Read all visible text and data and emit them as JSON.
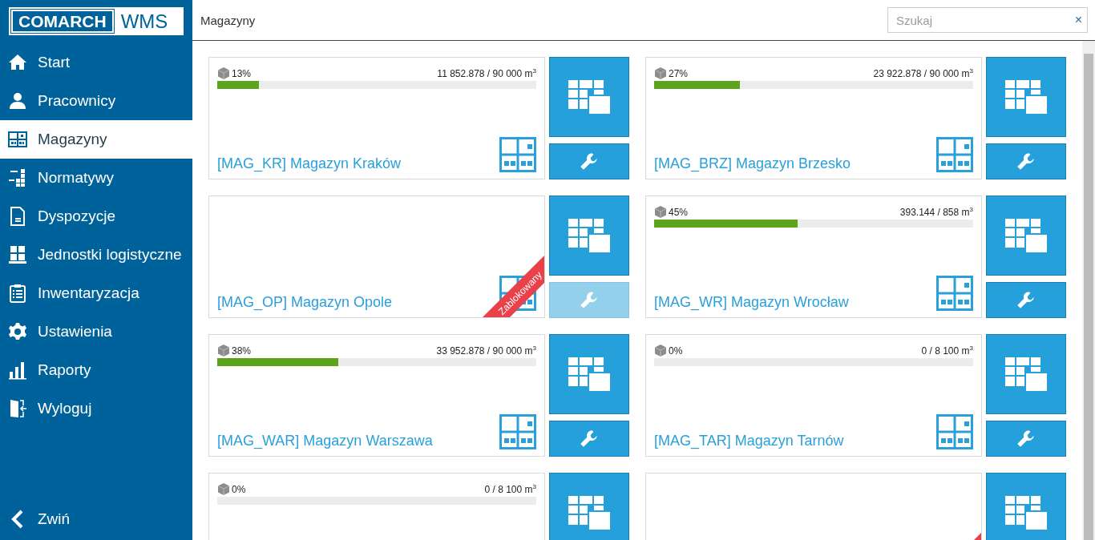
{
  "sidebar": {
    "logo": {
      "brand": "COMARCH",
      "product": "WMS"
    },
    "items": [
      {
        "label": "Start",
        "selected": false
      },
      {
        "label": "Pracownicy",
        "selected": false
      },
      {
        "label": "Magazyny",
        "selected": true
      },
      {
        "label": "Normatywy",
        "selected": false
      },
      {
        "label": "Dyspozycje",
        "selected": false
      },
      {
        "label": "Jednostki logistyczne",
        "selected": false
      },
      {
        "label": "Inwentaryzacja",
        "selected": false
      },
      {
        "label": "Ustawienia",
        "selected": false
      },
      {
        "label": "Raporty",
        "selected": false
      },
      {
        "label": "Wyloguj",
        "selected": false
      }
    ],
    "collapse": "Zwiń"
  },
  "header": {
    "title": "Magazyny",
    "search": {
      "placeholder": "Szukaj",
      "clear": "×"
    }
  },
  "warehouses": [
    {
      "name": "[MAG_KR] Magazyn Kraków",
      "percent": "13%",
      "level": 0.13,
      "volume": "11 852.878 / 90 000 m$^{3}$",
      "blocked": false,
      "settings_disabled": false
    },
    {
      "name": "[MAG_BRZ] Magazyn Brzesko",
      "percent": "27%",
      "level": 0.27,
      "volume": "23 922.878 / 90 000 m$^{3}$",
      "blocked": false,
      "settings_disabled": false
    },
    {
      "name": "[MAG_OP] Magazyn Opole",
      "blocked": true,
      "ribbon": "Zablokowany",
      "settings_disabled": true
    },
    {
      "name": "[MAG_WR] Magazyn Wrocław",
      "percent": "45%",
      "level": 0.45,
      "volume": "393.144 / 858 m$^{3}$",
      "blocked": false,
      "settings_disabled": false
    },
    {
      "name": "[MAG_WAR] Magazyn Warszawa",
      "percent": "38%",
      "level": 0.38,
      "volume": "33 952.878 / 90 000 m$^{3}$",
      "blocked": false,
      "settings_disabled": false
    },
    {
      "name": "[MAG_TAR] Magazyn Tarnów",
      "percent": "0%",
      "level": 0,
      "volume": "0 / 8 100 m$^{3}$",
      "blocked": false,
      "settings_disabled": false
    },
    {
      "percent": "0%",
      "level": 0,
      "volume": "0 / 8 100 m$^{3}$",
      "blocked": false
    },
    {
      "blocked": true
    }
  ]
}
